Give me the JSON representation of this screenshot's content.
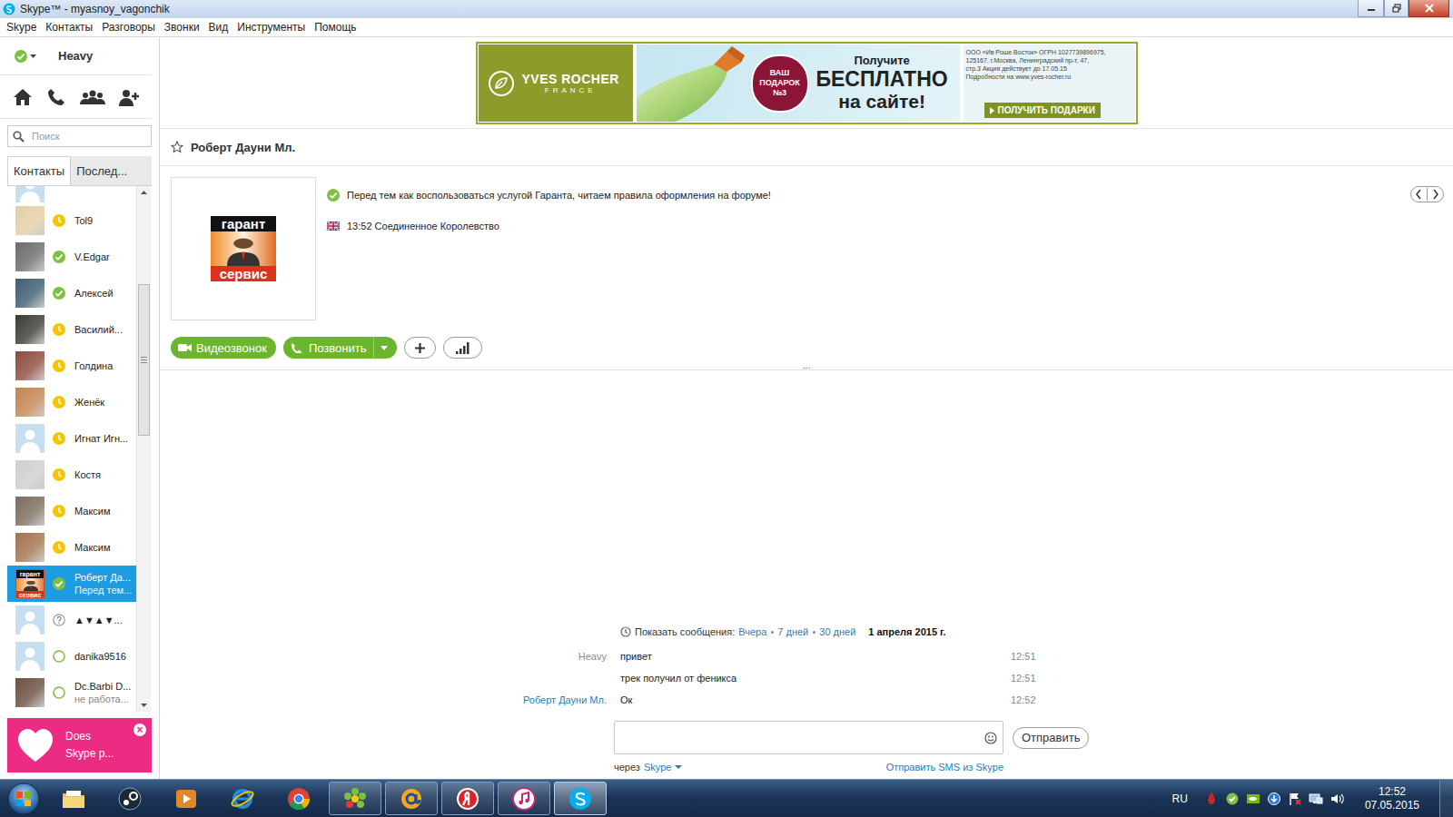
{
  "window": {
    "title": "Skype™ - myasnoy_vagonchik"
  },
  "menu": [
    "Skype",
    "Контакты",
    "Разговоры",
    "Звонки",
    "Вид",
    "Инструменты",
    "Помощь"
  ],
  "user": {
    "name": "Heavy",
    "status": "online"
  },
  "search": {
    "placeholder": "Поиск"
  },
  "sidebar_tabs": [
    {
      "label": "Контакты",
      "selected": true
    },
    {
      "label": "Послед...",
      "selected": false
    }
  ],
  "contacts": [
    {
      "name": "Tol9",
      "subtitle": "",
      "status": "away",
      "selected": false,
      "avatar_kind": "photo",
      "color": "#e2cfa4"
    },
    {
      "name": "V.Edgar",
      "subtitle": "",
      "status": "online",
      "selected": false,
      "avatar_kind": "photo",
      "color": "#6b6b6b"
    },
    {
      "name": "Алексей",
      "subtitle": "",
      "status": "online",
      "selected": false,
      "avatar_kind": "photo",
      "color": "#3d5d74"
    },
    {
      "name": "Василий...",
      "subtitle": "",
      "status": "away",
      "selected": false,
      "avatar_kind": "photo",
      "color": "#3b3a34"
    },
    {
      "name": "Голдина",
      "subtitle": "",
      "status": "away",
      "selected": false,
      "avatar_kind": "photo",
      "color": "#8d4b3c"
    },
    {
      "name": "Женёк",
      "subtitle": "",
      "status": "away",
      "selected": false,
      "avatar_kind": "photo",
      "color": "#c48450"
    },
    {
      "name": "Игнат Игн...",
      "subtitle": "",
      "status": "away",
      "selected": false,
      "avatar_kind": "default",
      "color": "#c5dff0"
    },
    {
      "name": "Костя",
      "subtitle": "",
      "status": "away",
      "selected": false,
      "avatar_kind": "photo",
      "color": "#cfcfcf"
    },
    {
      "name": "Максим",
      "subtitle": "",
      "status": "away",
      "selected": false,
      "avatar_kind": "photo",
      "color": "#7b6c5c"
    },
    {
      "name": "Максим",
      "subtitle": "",
      "status": "away",
      "selected": false,
      "avatar_kind": "photo",
      "color": "#a3734f"
    },
    {
      "name": "Роберт Да...",
      "subtitle": "Перед тем...",
      "status": "online",
      "selected": true,
      "avatar_kind": "logo",
      "color": "#d8461f"
    },
    {
      "name": "▲▼▲▼...",
      "subtitle": "",
      "status": "pending",
      "selected": false,
      "avatar_kind": "default",
      "color": "#c5dff0"
    },
    {
      "name": "danika9516",
      "subtitle": "",
      "status": "offline",
      "selected": false,
      "avatar_kind": "default",
      "color": "#c5dff0"
    },
    {
      "name": "Dc.Barbi D...",
      "subtitle": "не работа...",
      "status": "offline",
      "selected": false,
      "avatar_kind": "photo",
      "color": "#6b5040"
    }
  ],
  "sidebar_ad": {
    "lines": [
      "Does",
      "Skype p..."
    ],
    "close": "×"
  },
  "ad_banner": {
    "brand": "YVES ROCHER",
    "brand_sub": "FRANCE",
    "badge": [
      "ВАШ",
      "ПОДАРОК",
      "№3"
    ],
    "headline": [
      "Получите",
      "БЕСПЛАТНО",
      "на сайте!"
    ],
    "legal": [
      "ООО «Ив Роше Восток» ОГРН 1027739896975,",
      "125167, г.Москва, Ленинградский пр-т, 47,",
      "стр.3 Акция действует до 17.05.15",
      "Подробности на www.yves-rocher.ru"
    ],
    "cta": "ПОЛУЧИТЬ ПОДАРКИ"
  },
  "contact": {
    "name": "Роберт Дауни Мл.",
    "favorite": false,
    "status": "online",
    "mood": "Перед тем как воспользоваться услугой Гаранта, читаем правила оформления на форуме!",
    "local_time": "13:52 Соединенное Королевство",
    "logo": [
      "гарант",
      "сервис"
    ]
  },
  "actions": [
    {
      "label": "Видеозвонок",
      "kind": "video",
      "dropdown": false
    },
    {
      "label": "Позвонить",
      "kind": "call",
      "dropdown": true
    }
  ],
  "splitter": "...",
  "history": {
    "label": "Показать сообщения:",
    "options": [
      {
        "label": "Вчера",
        "selected": false
      },
      {
        "label": "7 дней",
        "selected": false
      },
      {
        "label": "30 дней",
        "selected": false
      },
      {
        "label": "1 апреля 2015 г.",
        "selected": true
      }
    ]
  },
  "messages": [
    {
      "sender": "Heavy",
      "text": "привет",
      "time": "12:51",
      "kind": "self"
    },
    {
      "sender": "",
      "text": "трек получил от феникса",
      "time": "12:51",
      "kind": "self"
    },
    {
      "sender": "Роберт Дауни Мл.",
      "text": "Ок",
      "time": "12:52",
      "kind": "other"
    }
  ],
  "composer": {
    "value": "",
    "send": "Отправить",
    "via_label": "через",
    "via": "Skype",
    "sms": "Отправить SMS из Skype"
  },
  "taskbar": {
    "apps": [
      {
        "kind": "explorer",
        "state": "pinned"
      },
      {
        "kind": "steam",
        "state": "pinned"
      },
      {
        "kind": "media",
        "state": "pinned"
      },
      {
        "kind": "ie",
        "state": "pinned"
      },
      {
        "kind": "chrome",
        "state": "pinned"
      },
      {
        "kind": "icq",
        "state": "running"
      },
      {
        "kind": "mail",
        "state": "running"
      },
      {
        "kind": "yandex",
        "state": "running"
      },
      {
        "kind": "itunes",
        "state": "running"
      },
      {
        "kind": "skype",
        "state": "active"
      }
    ],
    "language": "RU",
    "time": "12:52",
    "date": "07.05.2015"
  }
}
